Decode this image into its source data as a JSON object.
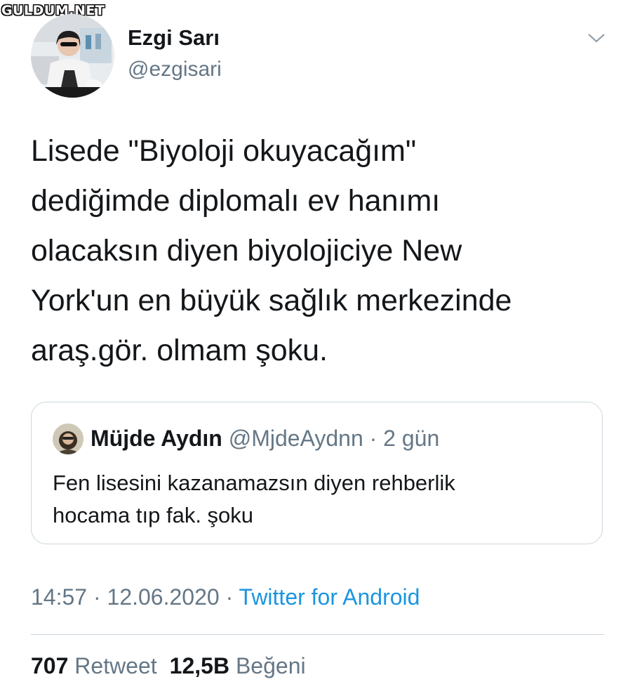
{
  "watermark": "GULDUM.NET",
  "author": {
    "name": "Ezgi Sarı",
    "handle": "@ezgisari"
  },
  "icons": {
    "menu": "chevron-down-icon"
  },
  "tweet": {
    "text": "Lisede \"Biyoloji okuyacağım\"\ndediğimde diplomalı ev hanımı\nolacaksın diyen biyolojiciye New\nYork'un en büyük sağlık merkezinde\naraş.gör. olmam şoku."
  },
  "quoted_tweet": {
    "name": "Müjde Aydın",
    "handle": "@MjdeAydnn",
    "separator": " · ",
    "time": "2 gün",
    "text": "Fen lisesini kazanamazsın diyen rehberlik\nhocama tıp fak. şoku"
  },
  "meta": {
    "time": "14:57",
    "separator": " · ",
    "date": "12.06.2020",
    "source": "Twitter for Android"
  },
  "stats": {
    "retweets_count": "707",
    "retweets_label": "Retweet",
    "likes_count": "12,5B",
    "likes_label": "Beğeni"
  },
  "colors": {
    "text": "#14171a",
    "secondary": "#657786",
    "link": "#1b95e0",
    "border": "#ccd6dd"
  }
}
